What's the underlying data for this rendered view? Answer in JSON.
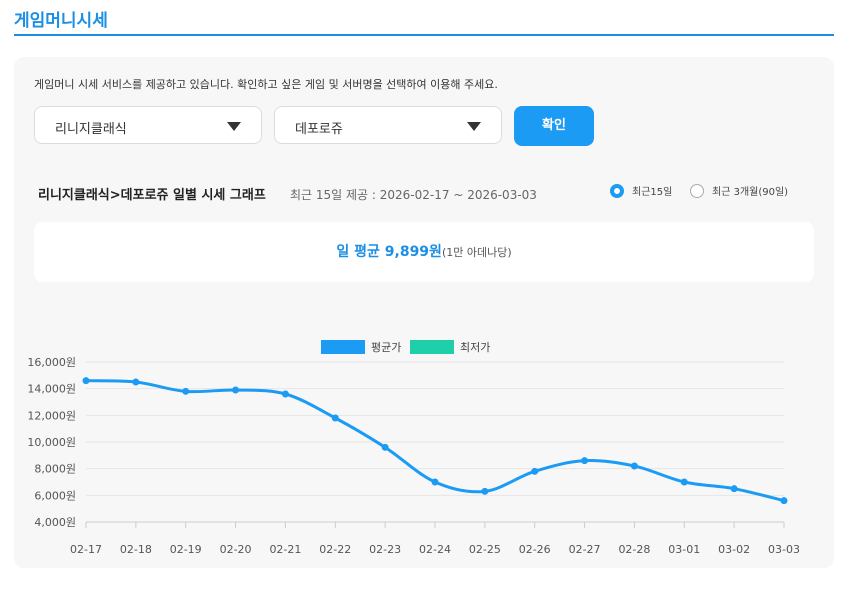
{
  "page": {
    "title": "게임머니시세"
  },
  "description": "게임머니 시세 서비스를 제공하고 있습니다. 확인하고 싶은 게임 및 서버명을 선택하여 이용해 주세요.",
  "filters": {
    "game_select": "리니지클래식",
    "server_select": "데포로쥬",
    "confirm_label": "확인"
  },
  "graph": {
    "title": "리니지클래식>데포로쥬 일별 시세 그래프",
    "subtitle": "최근 15일 제공 : 2026-02-17 ~ 2026-03-03",
    "period_options": [
      {
        "label": "최근15일",
        "selected": true
      },
      {
        "label": "최근 3개월(90일)",
        "selected": false
      }
    ],
    "daily_average_label": "일 평균 9,899원",
    "daily_average_unit": "(1만 아데나당)"
  },
  "colors": {
    "accent": "#1b9bf4",
    "lowest": "#1fcfaa",
    "title": "#1b8fe6"
  },
  "chart_data": {
    "type": "line",
    "x": [
      "02-17",
      "02-18",
      "02-19",
      "02-20",
      "02-21",
      "02-22",
      "02-23",
      "02-24",
      "02-25",
      "02-26",
      "02-27",
      "02-28",
      "03-01",
      "03-02",
      "03-03"
    ],
    "series": [
      {
        "name": "평균가",
        "color": "#1b9bf4",
        "values": [
          14600,
          14500,
          13800,
          13900,
          13600,
          11800,
          9600,
          7000,
          6300,
          7800,
          8600,
          8200,
          7000,
          6500,
          5600
        ]
      },
      {
        "name": "최저가",
        "color": "#1fcfaa",
        "values": []
      }
    ],
    "ylim": [
      4000,
      16000
    ],
    "y_ticks": [
      "4,000원",
      "6,000원",
      "8,000원",
      "10,000원",
      "12,000원",
      "14,000원",
      "16,000원"
    ],
    "legend": "top-center",
    "grid": true
  }
}
